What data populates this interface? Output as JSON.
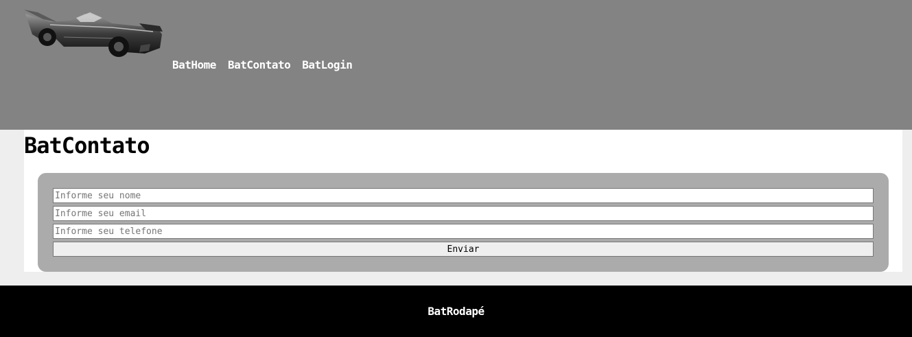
{
  "colors": {
    "header_bg": "#838383",
    "page_bg": "#eeeeee",
    "form_bg": "#ababab",
    "footer_bg": "#000000"
  },
  "header": {
    "logo_icon": "batmobile-logo-icon",
    "nav": [
      {
        "label": "BatHome"
      },
      {
        "label": "BatContato"
      },
      {
        "label": "BatLogin"
      }
    ]
  },
  "main": {
    "title": "BatContato",
    "form": {
      "name_placeholder": "Informe seu nome",
      "name_value": "",
      "email_placeholder": "Informe seu email",
      "email_value": "",
      "phone_placeholder": "Informe seu telefone",
      "phone_value": "",
      "submit_label": "Enviar"
    }
  },
  "footer": {
    "text": "BatRodapé"
  }
}
